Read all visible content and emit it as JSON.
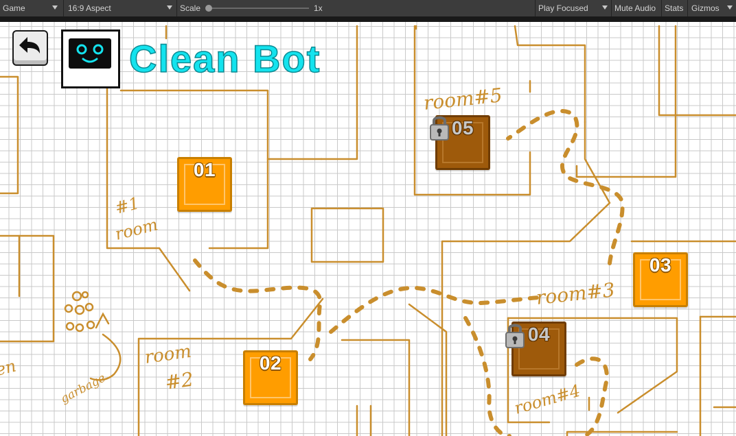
{
  "toolbar": {
    "display": "Game",
    "aspect": "16:9 Aspect",
    "scale_label": "Scale",
    "scale_value": "1x",
    "play_mode": "Play Focused",
    "mute_audio": "Mute Audio",
    "stats": "Stats",
    "gizmos": "Gizmos"
  },
  "header": {
    "title": "Clean Bot",
    "back_icon": "back-arrow-icon",
    "logo_icon": "robot-face-icon"
  },
  "map": {
    "labels": {
      "room1_a": "#1",
      "room1_b": "room",
      "room2_a": "room",
      "room2_b": "#2",
      "room3": "room#3",
      "room4": "room#4",
      "room5": "room#5",
      "garbage": "garbage",
      "left_edge": "en"
    },
    "colors": {
      "ink": "#c98e2d",
      "grid": "#c9c9c9"
    }
  },
  "levels": [
    {
      "number": "01",
      "locked": false
    },
    {
      "number": "02",
      "locked": false
    },
    {
      "number": "03",
      "locked": false
    },
    {
      "number": "04",
      "locked": true
    },
    {
      "number": "05",
      "locked": true
    }
  ],
  "colors": {
    "title": "#14e3ee",
    "level_unlocked": "#ff9d00",
    "level_locked": "#9e5a0b",
    "toolbar": "#3c3c3c"
  }
}
